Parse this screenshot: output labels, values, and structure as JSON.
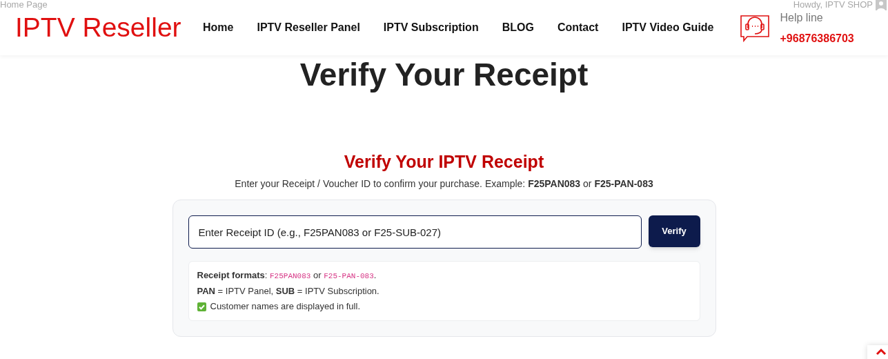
{
  "admin_bar": {
    "left": "Home Page",
    "right": "Howdy, IPTV SHOP"
  },
  "header": {
    "logo": "IPTV Reseller",
    "nav": [
      {
        "label": "Home"
      },
      {
        "label": "IPTV Reseller Panel"
      },
      {
        "label": "IPTV Subscription"
      },
      {
        "label": "BLOG"
      },
      {
        "label": "Contact"
      },
      {
        "label": "IPTV Video Guide"
      }
    ],
    "help": {
      "label": "Help line",
      "phone": "+96876386703"
    }
  },
  "page_title": "Verify Your Receipt",
  "verify": {
    "heading": "Verify Your IPTV Receipt",
    "intro": "Enter your Receipt / Voucher ID to confirm your purchase. Example: **F25PAN083** or **F25-PAN-083**",
    "placeholder": "Enter Receipt ID (e.g., F25PAN083 or F25-SUB-027)",
    "button": "Verify",
    "notes": [
      {
        "kind": "parts",
        "parts": [
          {
            "kind": "text",
            "text": "**Receipt formats**: "
          },
          {
            "kind": "code",
            "text": "F25PAN083"
          },
          {
            "kind": "text",
            "text": " or "
          },
          {
            "kind": "code",
            "text": "F25-PAN-083"
          },
          {
            "kind": "text",
            "text": "."
          }
        ]
      },
      {
        "kind": "text",
        "text": "**PAN** = IPTV Panel, **SUB** = IPTV Subscription."
      },
      {
        "kind": "check",
        "text": "Customer names are displayed in full."
      }
    ]
  }
}
